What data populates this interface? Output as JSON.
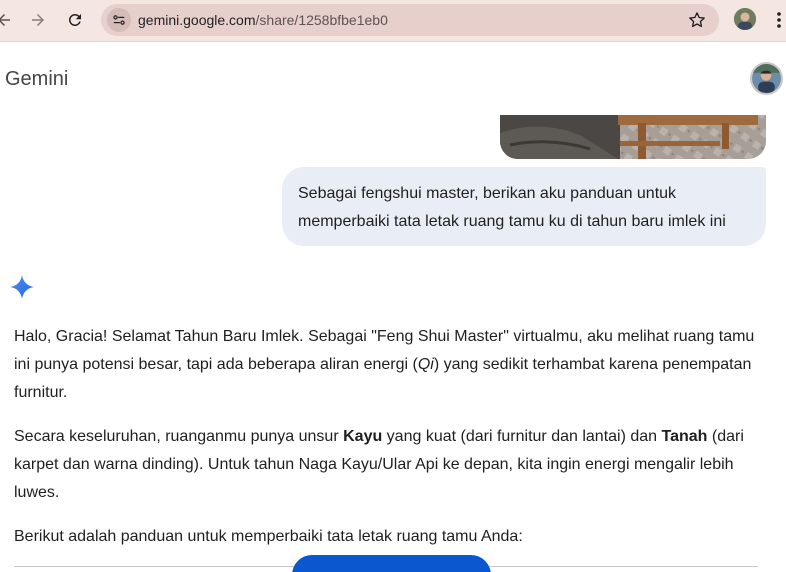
{
  "browser": {
    "url_host": "gemini.google.com",
    "url_path": "/share/1258bfbe1eb0",
    "icons": [
      "back-arrow-icon",
      "forward-arrow-icon",
      "reload-icon",
      "site-info-icon",
      "bookmark-star-icon",
      "profile-icon",
      "menu-dots-icon"
    ]
  },
  "header": {
    "title": "Gemini"
  },
  "conversation": {
    "user_prompt": "Sebagai fengshui master, berikan aku panduan untuk memperbaiki tata letak ruang tamu ku di tahun baru imlek ini",
    "response": {
      "p1": {
        "a": "Halo, Gracia! Selamat Tahun Baru Imlek. Sebagai \"Feng Shui Master\" virtualmu, aku melihat ruang tamu ini punya potensi besar, tapi ada beberapa aliran energi (",
        "qi": "Qi",
        "b": ") yang sedikit terhambat karena penempatan furnitur."
      },
      "p2": {
        "a": "Secara keseluruhan, ruanganmu punya unsur ",
        "kayu": "Kayu",
        "b": " yang kuat (dari furnitur dan lantai) dan ",
        "tanah": "Tanah",
        "c": " (dari karpet dan warna dinding). Untuk tahun Naga Kayu/Ular Api ke depan, kita ingin energi mengalir lebih luwes."
      },
      "p3": "Berikut adalah panduan untuk memperbaiki tata letak ruang tamu Anda:"
    }
  },
  "colors": {
    "toolbar_bg": "#f4e6e1",
    "omnibox_bg": "#e7cfcb",
    "user_bubble_bg": "#e9eef6",
    "accent_blue": "#0b57d0"
  }
}
